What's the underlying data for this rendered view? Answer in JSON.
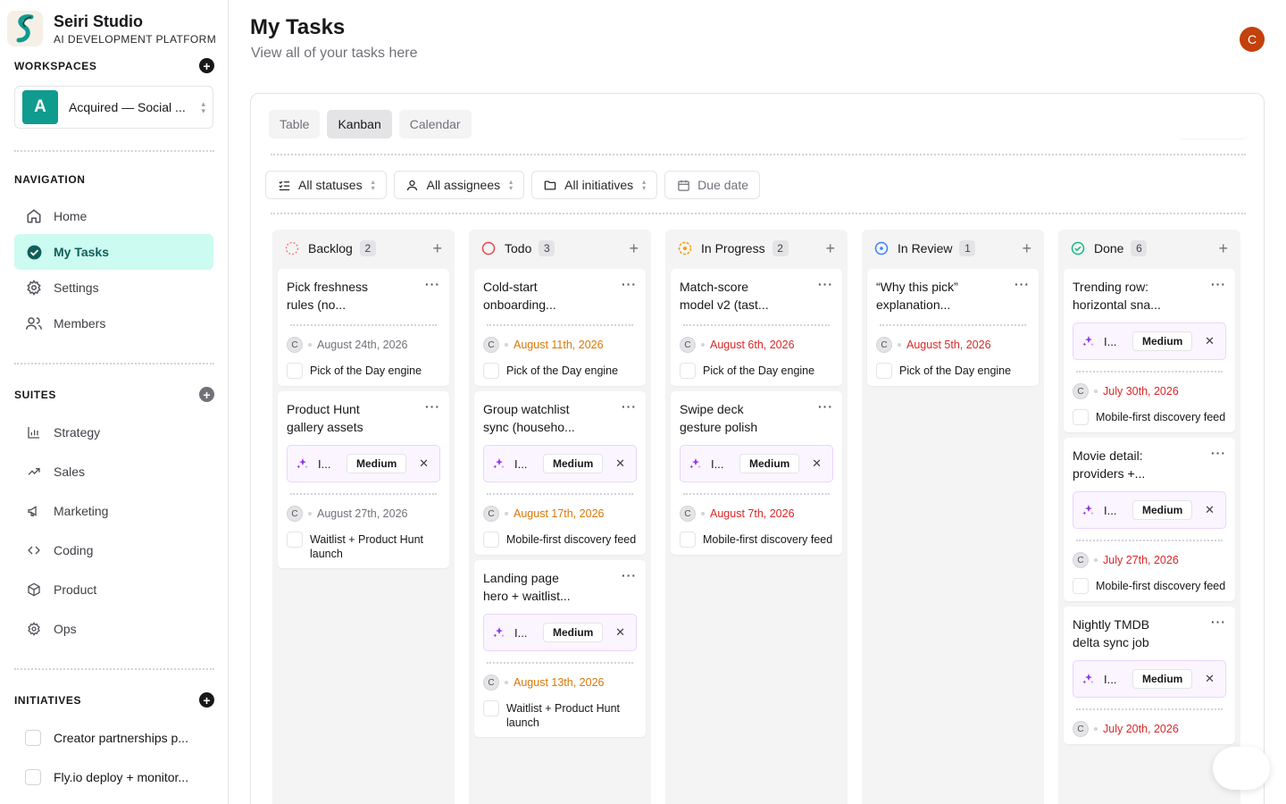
{
  "brand": {
    "name": "Seiri Studio",
    "tagline": "AI DEVELOPMENT PLATFORM"
  },
  "workspaces": {
    "title": "WORKSPACES",
    "current": {
      "initial": "A",
      "name": "Acquired — Social ..."
    }
  },
  "navigation": {
    "title": "NAVIGATION",
    "items": [
      {
        "label": "Home",
        "icon": "home-icon"
      },
      {
        "label": "My Tasks",
        "icon": "check-circle-icon",
        "active": true
      },
      {
        "label": "Settings",
        "icon": "gear-icon"
      },
      {
        "label": "Members",
        "icon": "users-icon"
      }
    ]
  },
  "suites": {
    "title": "SUITES",
    "items": [
      {
        "label": "Strategy",
        "icon": "bar-chart-icon"
      },
      {
        "label": "Sales",
        "icon": "trending-up-icon"
      },
      {
        "label": "Marketing",
        "icon": "megaphone-icon"
      },
      {
        "label": "Coding",
        "icon": "code-icon"
      },
      {
        "label": "Product",
        "icon": "box-icon"
      },
      {
        "label": "Ops",
        "icon": "cog-icon"
      }
    ]
  },
  "initiatives": {
    "title": "INITIATIVES",
    "items": [
      {
        "label": "Creator partnerships p..."
      },
      {
        "label": "Fly.io deploy + monitor..."
      }
    ]
  },
  "header": {
    "title": "My Tasks",
    "subtitle": "View all of your tasks here",
    "user_initial": "C"
  },
  "tabs": [
    {
      "label": "Table"
    },
    {
      "label": "Kanban",
      "active": true
    },
    {
      "label": "Calendar"
    }
  ],
  "filters": [
    {
      "label": "All statuses",
      "icon": "list-check-icon"
    },
    {
      "label": "All assignees",
      "icon": "user-icon"
    },
    {
      "label": "All initiatives",
      "icon": "folder-icon"
    },
    {
      "label": "Due date",
      "icon": "calendar-icon"
    }
  ],
  "colors": {
    "accent": "#0f9b8e",
    "active_bg": "#ccfbf1",
    "avatar": "#c2410c",
    "due_red": "#dc2626",
    "due_orange": "#d97706",
    "chip_purple": "#9333ea"
  },
  "columns": [
    {
      "title": "Backlog",
      "count": "2",
      "status": "backlog",
      "cards": [
        {
          "title1": "Pick freshness",
          "title2": "rules (no...",
          "chip": null,
          "avatar": "C",
          "due": "August 24th, 2026",
          "due_color": "gray",
          "initiative": "Pick of the Day engine"
        },
        {
          "title1": "Product Hunt",
          "title2": "gallery assets",
          "chip": {
            "label": "I...",
            "priority": "Medium"
          },
          "avatar": "C",
          "due": "August 27th, 2026",
          "due_color": "gray",
          "initiative": "Waitlist + Product Hunt launch"
        }
      ]
    },
    {
      "title": "Todo",
      "count": "3",
      "status": "todo",
      "cards": [
        {
          "title1": "Cold-start",
          "title2": "onboarding...",
          "chip": null,
          "avatar": "C",
          "due": "August 11th, 2026",
          "due_color": "orange",
          "initiative": "Pick of the Day engine"
        },
        {
          "title1": "Group watchlist",
          "title2": "sync (househo...",
          "chip": {
            "label": "I...",
            "priority": "Medium"
          },
          "avatar": "C",
          "due": "August 17th, 2026",
          "due_color": "orange",
          "initiative": "Mobile-first discovery feed"
        },
        {
          "title1": "Landing page",
          "title2": "hero + waitlist...",
          "chip": {
            "label": "I...",
            "priority": "Medium"
          },
          "avatar": "C",
          "due": "August 13th, 2026",
          "due_color": "orange",
          "initiative": "Waitlist + Product Hunt launch"
        }
      ]
    },
    {
      "title": "In Progress",
      "count": "2",
      "status": "progress",
      "cards": [
        {
          "title1": "Match-score",
          "title2": "model v2 (tast...",
          "chip": null,
          "avatar": "C",
          "due": "August 6th, 2026",
          "due_color": "red",
          "initiative": "Pick of the Day engine"
        },
        {
          "title1": "Swipe deck",
          "title2": "gesture polish",
          "chip": {
            "label": "I...",
            "priority": "Medium"
          },
          "avatar": "C",
          "due": "August 7th, 2026",
          "due_color": "red",
          "initiative": "Mobile-first discovery feed"
        }
      ]
    },
    {
      "title": "In Review",
      "count": "1",
      "status": "review",
      "cards": [
        {
          "title1": "“Why this pick”",
          "title2": "explanation...",
          "chip": null,
          "avatar": "C",
          "due": "August 5th, 2026",
          "due_color": "red",
          "initiative": "Pick of the Day engine"
        }
      ]
    },
    {
      "title": "Done",
      "count": "6",
      "status": "done",
      "cards": [
        {
          "title1": "Trending row:",
          "title2": "horizontal sna...",
          "chip": {
            "label": "I...",
            "priority": "Medium"
          },
          "avatar": "C",
          "due": "July 30th, 2026",
          "due_color": "red",
          "initiative": "Mobile-first discovery feed"
        },
        {
          "title1": "Movie detail:",
          "title2": "providers +...",
          "chip": {
            "label": "I...",
            "priority": "Medium"
          },
          "avatar": "C",
          "due": "July 27th, 2026",
          "due_color": "red",
          "initiative": "Mobile-first discovery feed"
        },
        {
          "title1": "Nightly TMDB",
          "title2": "delta sync job",
          "chip": {
            "label": "I...",
            "priority": "Medium"
          },
          "avatar": "C",
          "due": "July 20th, 2026",
          "due_color": "red",
          "initiative": ""
        }
      ]
    }
  ]
}
